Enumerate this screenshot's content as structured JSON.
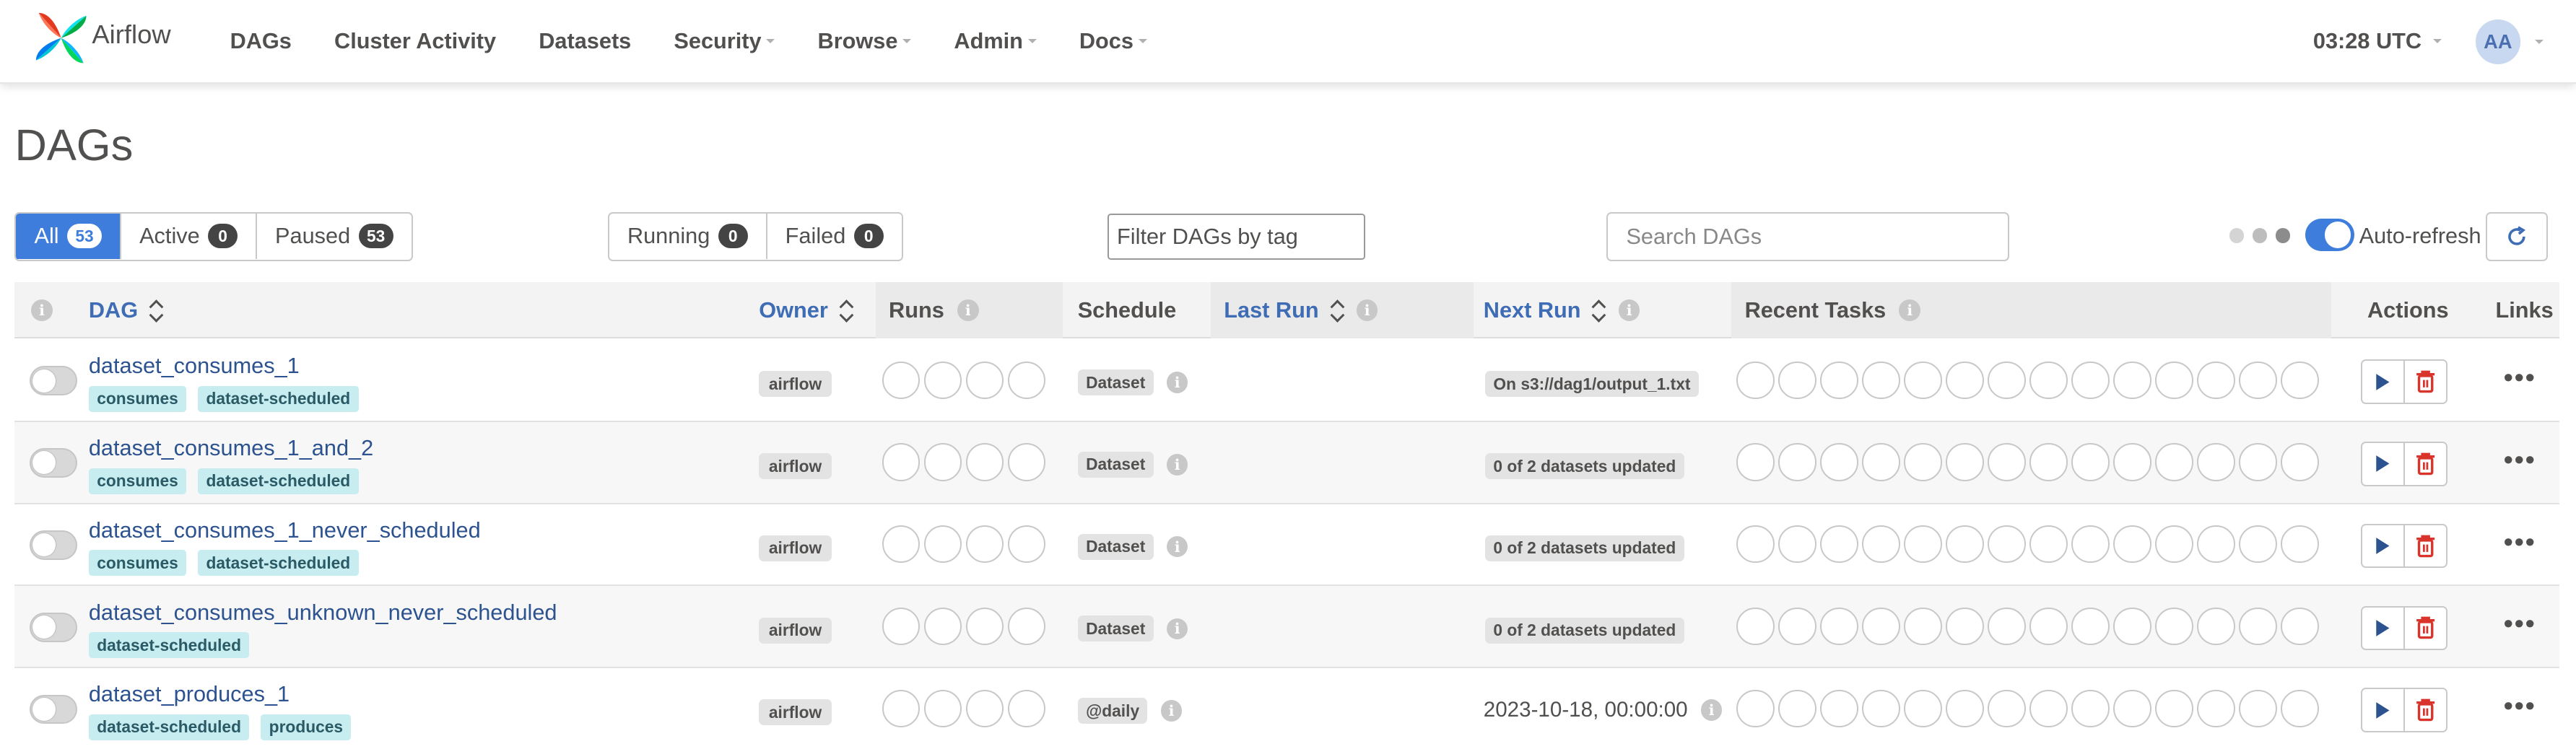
{
  "brand": {
    "name": "Airflow"
  },
  "nav": {
    "items": [
      {
        "label": "DAGs",
        "has_caret": false
      },
      {
        "label": "Cluster Activity",
        "has_caret": false
      },
      {
        "label": "Datasets",
        "has_caret": false
      },
      {
        "label": "Security",
        "has_caret": true
      },
      {
        "label": "Browse",
        "has_caret": true
      },
      {
        "label": "Admin",
        "has_caret": true
      },
      {
        "label": "Docs",
        "has_caret": true
      }
    ],
    "time": "03:28 UTC",
    "user_initials": "AA"
  },
  "page": {
    "title": "DAGs"
  },
  "filters": {
    "status": [
      {
        "label": "All",
        "count": "53",
        "active": true
      },
      {
        "label": "Active",
        "count": "0",
        "active": false
      },
      {
        "label": "Paused",
        "count": "53",
        "active": false
      }
    ],
    "runs": [
      {
        "label": "Running",
        "count": "0"
      },
      {
        "label": "Failed",
        "count": "0"
      }
    ],
    "tag_placeholder": "Filter DAGs by tag",
    "search_placeholder": "Search DAGs",
    "auto_refresh_label": "Auto-refresh",
    "auto_refresh_on": true
  },
  "table": {
    "columns": {
      "dag": "DAG",
      "owner": "Owner",
      "runs": "Runs",
      "schedule": "Schedule",
      "last_run": "Last Run",
      "next_run": "Next Run",
      "recent_tasks": "Recent Tasks",
      "actions": "Actions",
      "links": "Links"
    },
    "rows": [
      {
        "dag_id": "dataset_consumes_1",
        "tags": [
          "consumes",
          "dataset-scheduled"
        ],
        "owner": "airflow",
        "schedule": "Dataset",
        "next_run": "On s3://dag1/output_1.txt",
        "next_run_style": "pill"
      },
      {
        "dag_id": "dataset_consumes_1_and_2",
        "tags": [
          "consumes",
          "dataset-scheduled"
        ],
        "owner": "airflow",
        "schedule": "Dataset",
        "next_run": "0 of 2 datasets updated",
        "next_run_style": "pill"
      },
      {
        "dag_id": "dataset_consumes_1_never_scheduled",
        "tags": [
          "consumes",
          "dataset-scheduled"
        ],
        "owner": "airflow",
        "schedule": "Dataset",
        "next_run": "0 of 2 datasets updated",
        "next_run_style": "pill"
      },
      {
        "dag_id": "dataset_consumes_unknown_never_scheduled",
        "tags": [
          "dataset-scheduled"
        ],
        "owner": "airflow",
        "schedule": "Dataset",
        "next_run": "0 of 2 datasets updated",
        "next_run_style": "pill"
      },
      {
        "dag_id": "dataset_produces_1",
        "tags": [
          "dataset-scheduled",
          "produces"
        ],
        "owner": "airflow",
        "schedule": "@daily",
        "next_run": "2023-10-18, 00:00:00",
        "next_run_style": "text"
      }
    ]
  },
  "icons": {
    "logo": "airflow-pinwheel-icon",
    "play": "play-icon",
    "delete": "trash-icon",
    "more": "more-horizontal-icon",
    "refresh": "refresh-icon",
    "info": "info-icon",
    "sort": "sort-icon"
  },
  "colors": {
    "primary": "#3e7ddc",
    "link": "#2c5390",
    "danger": "#d9342b",
    "tag_bg": "#c8edf0"
  }
}
